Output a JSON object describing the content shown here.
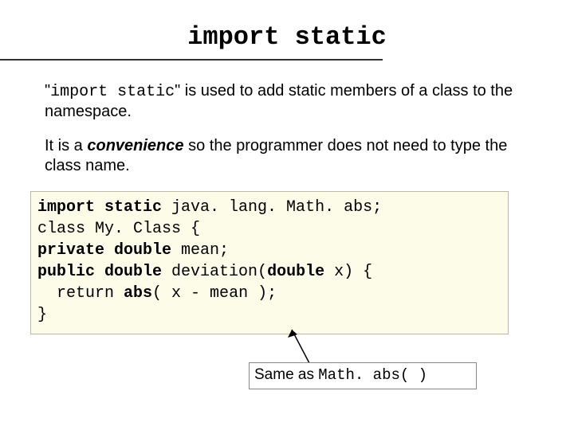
{
  "title": "import static",
  "para1_pre": "\"",
  "para1_code": "import static",
  "para1_post": "\" is used to add static members of a class to the namespace.",
  "para2_pre": "It is a ",
  "para2_em": "convenience",
  "para2_post": " so the programmer does not need to type the class name.",
  "code": {
    "l1a": "import static",
    "l1b": " java. lang. Math. abs;",
    "l2": "class My. Class {",
    "l3a": "private double",
    "l3b": " mean;",
    "l4a": "public double",
    "l4b": " deviation(",
    "l4c": "double",
    "l4d": " x) {",
    "l5a": "  return ",
    "l5b": "abs",
    "l5c": "( x - mean );",
    "l6": "}"
  },
  "callout_pre": "Same as ",
  "callout_mono": "Math. abs( )"
}
